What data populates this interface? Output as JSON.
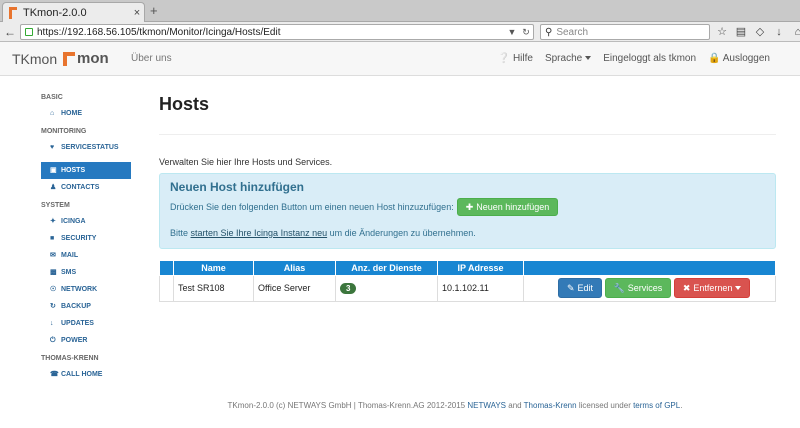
{
  "browser": {
    "tab_title": "TKmon-2.0.0",
    "tab_close": "×",
    "newtab": "+",
    "url": "https://192.168.56.105/tkmon/Monitor/Icinga/Hosts/Edit",
    "search_placeholder": "Search"
  },
  "header": {
    "brand": "TKmon",
    "logo_text": "mon",
    "about": "Über uns",
    "help": "Hilfe",
    "language": "Sprache",
    "logged_in": "Eingeloggt als tkmon",
    "logout": "Ausloggen"
  },
  "sidebar": {
    "basic_heading": "BASIC",
    "home": "HOME",
    "monitoring_heading": "MONITORING",
    "servicestatus": "SERVICESTATUS",
    "hosts": "HOSTS",
    "contacts": "CONTACTS",
    "system_heading": "SYSTEM",
    "icinga": "ICINGA",
    "security": "SECURITY",
    "mail": "MAIL",
    "sms": "SMS",
    "network": "NETWORK",
    "backup": "BACKUP",
    "updates": "UPDATES",
    "power": "POWER",
    "tk_heading": "THOMAS-KRENN",
    "callhome": "CALL HOME"
  },
  "main": {
    "title": "Hosts",
    "intro": "Verwalten Sie hier Ihre Hosts und Services.",
    "box_title": "Neuen Host hinzufügen",
    "box_text": "Drücken Sie den folgenden Button um einen neuen Host hinzuzufügen:",
    "add_button": "Neuen hinzufügen",
    "note_before": "Bitte ",
    "note_link": "starten Sie Ihre Icinga Instanz neu",
    "note_after": " um die Änderungen zu übernehmen."
  },
  "table": {
    "columns": [
      "Name",
      "Alias",
      "Anz. der Dienste",
      "IP Adresse"
    ],
    "rows": [
      {
        "name": "Test SR108",
        "alias": "Office Server",
        "services": "3",
        "ip": "10.1.102.11"
      }
    ],
    "edit": "Edit",
    "services_btn": "Services",
    "remove": "Entfernen"
  },
  "footer": {
    "text1": "TKmon-2.0.0 (c) NETWAYS GmbH | Thomas-Krenn.AG 2012-2015 ",
    "netways": "NETWAYS",
    "and": " and ",
    "tk": "Thomas-Krenn",
    "licensed": " licensed under ",
    "gpl": "terms of GPL",
    "dot": "."
  },
  "colors": {
    "accent": "#e8742e",
    "active_nav": "#2679c0",
    "table_header": "#1886d2",
    "success": "#5cb85c",
    "primary": "#337ab7",
    "danger": "#d9534f"
  }
}
